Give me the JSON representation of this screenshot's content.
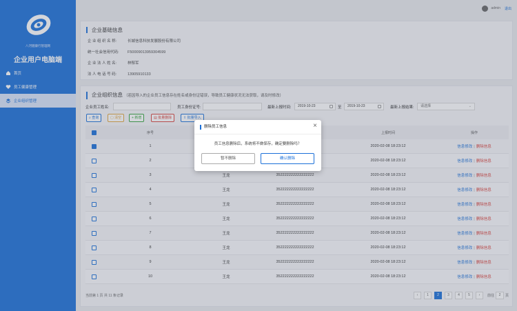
{
  "sidebar": {
    "org_name": "八河健康行管理网",
    "app_title": "企业用户电脑端",
    "items": [
      {
        "label": "首页",
        "icon": "home-icon"
      },
      {
        "label": "员工健康管理",
        "icon": "heart-icon"
      },
      {
        "label": "企业组织管理",
        "icon": "layers-icon"
      }
    ]
  },
  "topbar": {
    "user": "admin",
    "logout": "退出"
  },
  "basic_info": {
    "title": "企业基础信息",
    "rows": [
      {
        "k": "企 业 组 织 名 称:",
        "v": "长城信息科技发展股份有限公司"
      },
      {
        "k": "统一社会信用代码:",
        "v": "F50009013959304599"
      },
      {
        "k": "企 业 法 人 姓 名:",
        "v": "林郁军"
      },
      {
        "k": "法 人 电 话 号 码:",
        "v": "13905910133"
      }
    ]
  },
  "org_info": {
    "title": "企业组织信息",
    "note": "（若因导入的企业员工信息存在姓名或身份证错误，导致员工健康状况无法获取，请及时修改）"
  },
  "filters": {
    "name_label": "企业员工姓名:",
    "id_label": "员工身份证号:",
    "time_label": "最新上报时间:",
    "date_from": "2019-10-23",
    "to": "至",
    "date_to": "2019-10-23",
    "result_label": "最新上报结果:",
    "result_placeholder": "请选择"
  },
  "toolbar": {
    "query": "查询",
    "clear": "清空",
    "add": "新增",
    "batch_delete": "批量删除",
    "batch_import": "批量导入"
  },
  "table": {
    "headers": [
      "序号",
      "",
      "",
      "上报时间",
      "操作"
    ],
    "rows": [
      {
        "no": "1",
        "name": "",
        "id": "",
        "time": "2020-02-08 18:23:12",
        "checked": true
      },
      {
        "no": "2",
        "name": "",
        "id": "",
        "time": "2020-02-08 18:23:12",
        "checked": false
      },
      {
        "no": "3",
        "name": "王龙",
        "id": "352222222222222222",
        "time": "2020-02-08 18:23:12",
        "checked": false
      },
      {
        "no": "4",
        "name": "王龙",
        "id": "352222222222222222",
        "time": "2020-02-08 18:23:12",
        "checked": false
      },
      {
        "no": "5",
        "name": "王龙",
        "id": "352222222222222222",
        "time": "2020-02-08 18:23:12",
        "checked": false
      },
      {
        "no": "6",
        "name": "王龙",
        "id": "352222222222222222",
        "time": "2020-02-08 18:23:12",
        "checked": false
      },
      {
        "no": "7",
        "name": "王龙",
        "id": "352222222222222222",
        "time": "2020-02-08 18:23:12",
        "checked": false
      },
      {
        "no": "8",
        "name": "王龙",
        "id": "352222222222222222",
        "time": "2020-02-08 18:23:12",
        "checked": false
      },
      {
        "no": "9",
        "name": "王龙",
        "id": "352222222222222222",
        "time": "2020-02-08 18:23:12",
        "checked": false
      },
      {
        "no": "10",
        "name": "王龙",
        "id": "352222222222222222",
        "time": "2020-02-08 18:23:12",
        "checked": false
      }
    ],
    "action_edit": "信息修改",
    "action_sep": "|",
    "action_delete": "删除信息"
  },
  "pagination": {
    "total_text": "当前第 1 页 共 11 条记录",
    "prev": "‹",
    "pages": [
      "1",
      "2",
      "3",
      "4",
      "5"
    ],
    "current": "2",
    "next": "›",
    "jump_prefix": "前往",
    "jump_value": "2",
    "jump_suffix": "页"
  },
  "modal": {
    "title": "删除员工信息",
    "close": "×",
    "message": "员工信息删除后，系统将不做保存，确定要删除吗？",
    "cancel": "暂不删除",
    "confirm": "确认删除"
  },
  "colors": {
    "primary": "#1a6fd8",
    "danger": "#d9403a",
    "success": "#33a33a",
    "warning": "#e0a43a"
  }
}
